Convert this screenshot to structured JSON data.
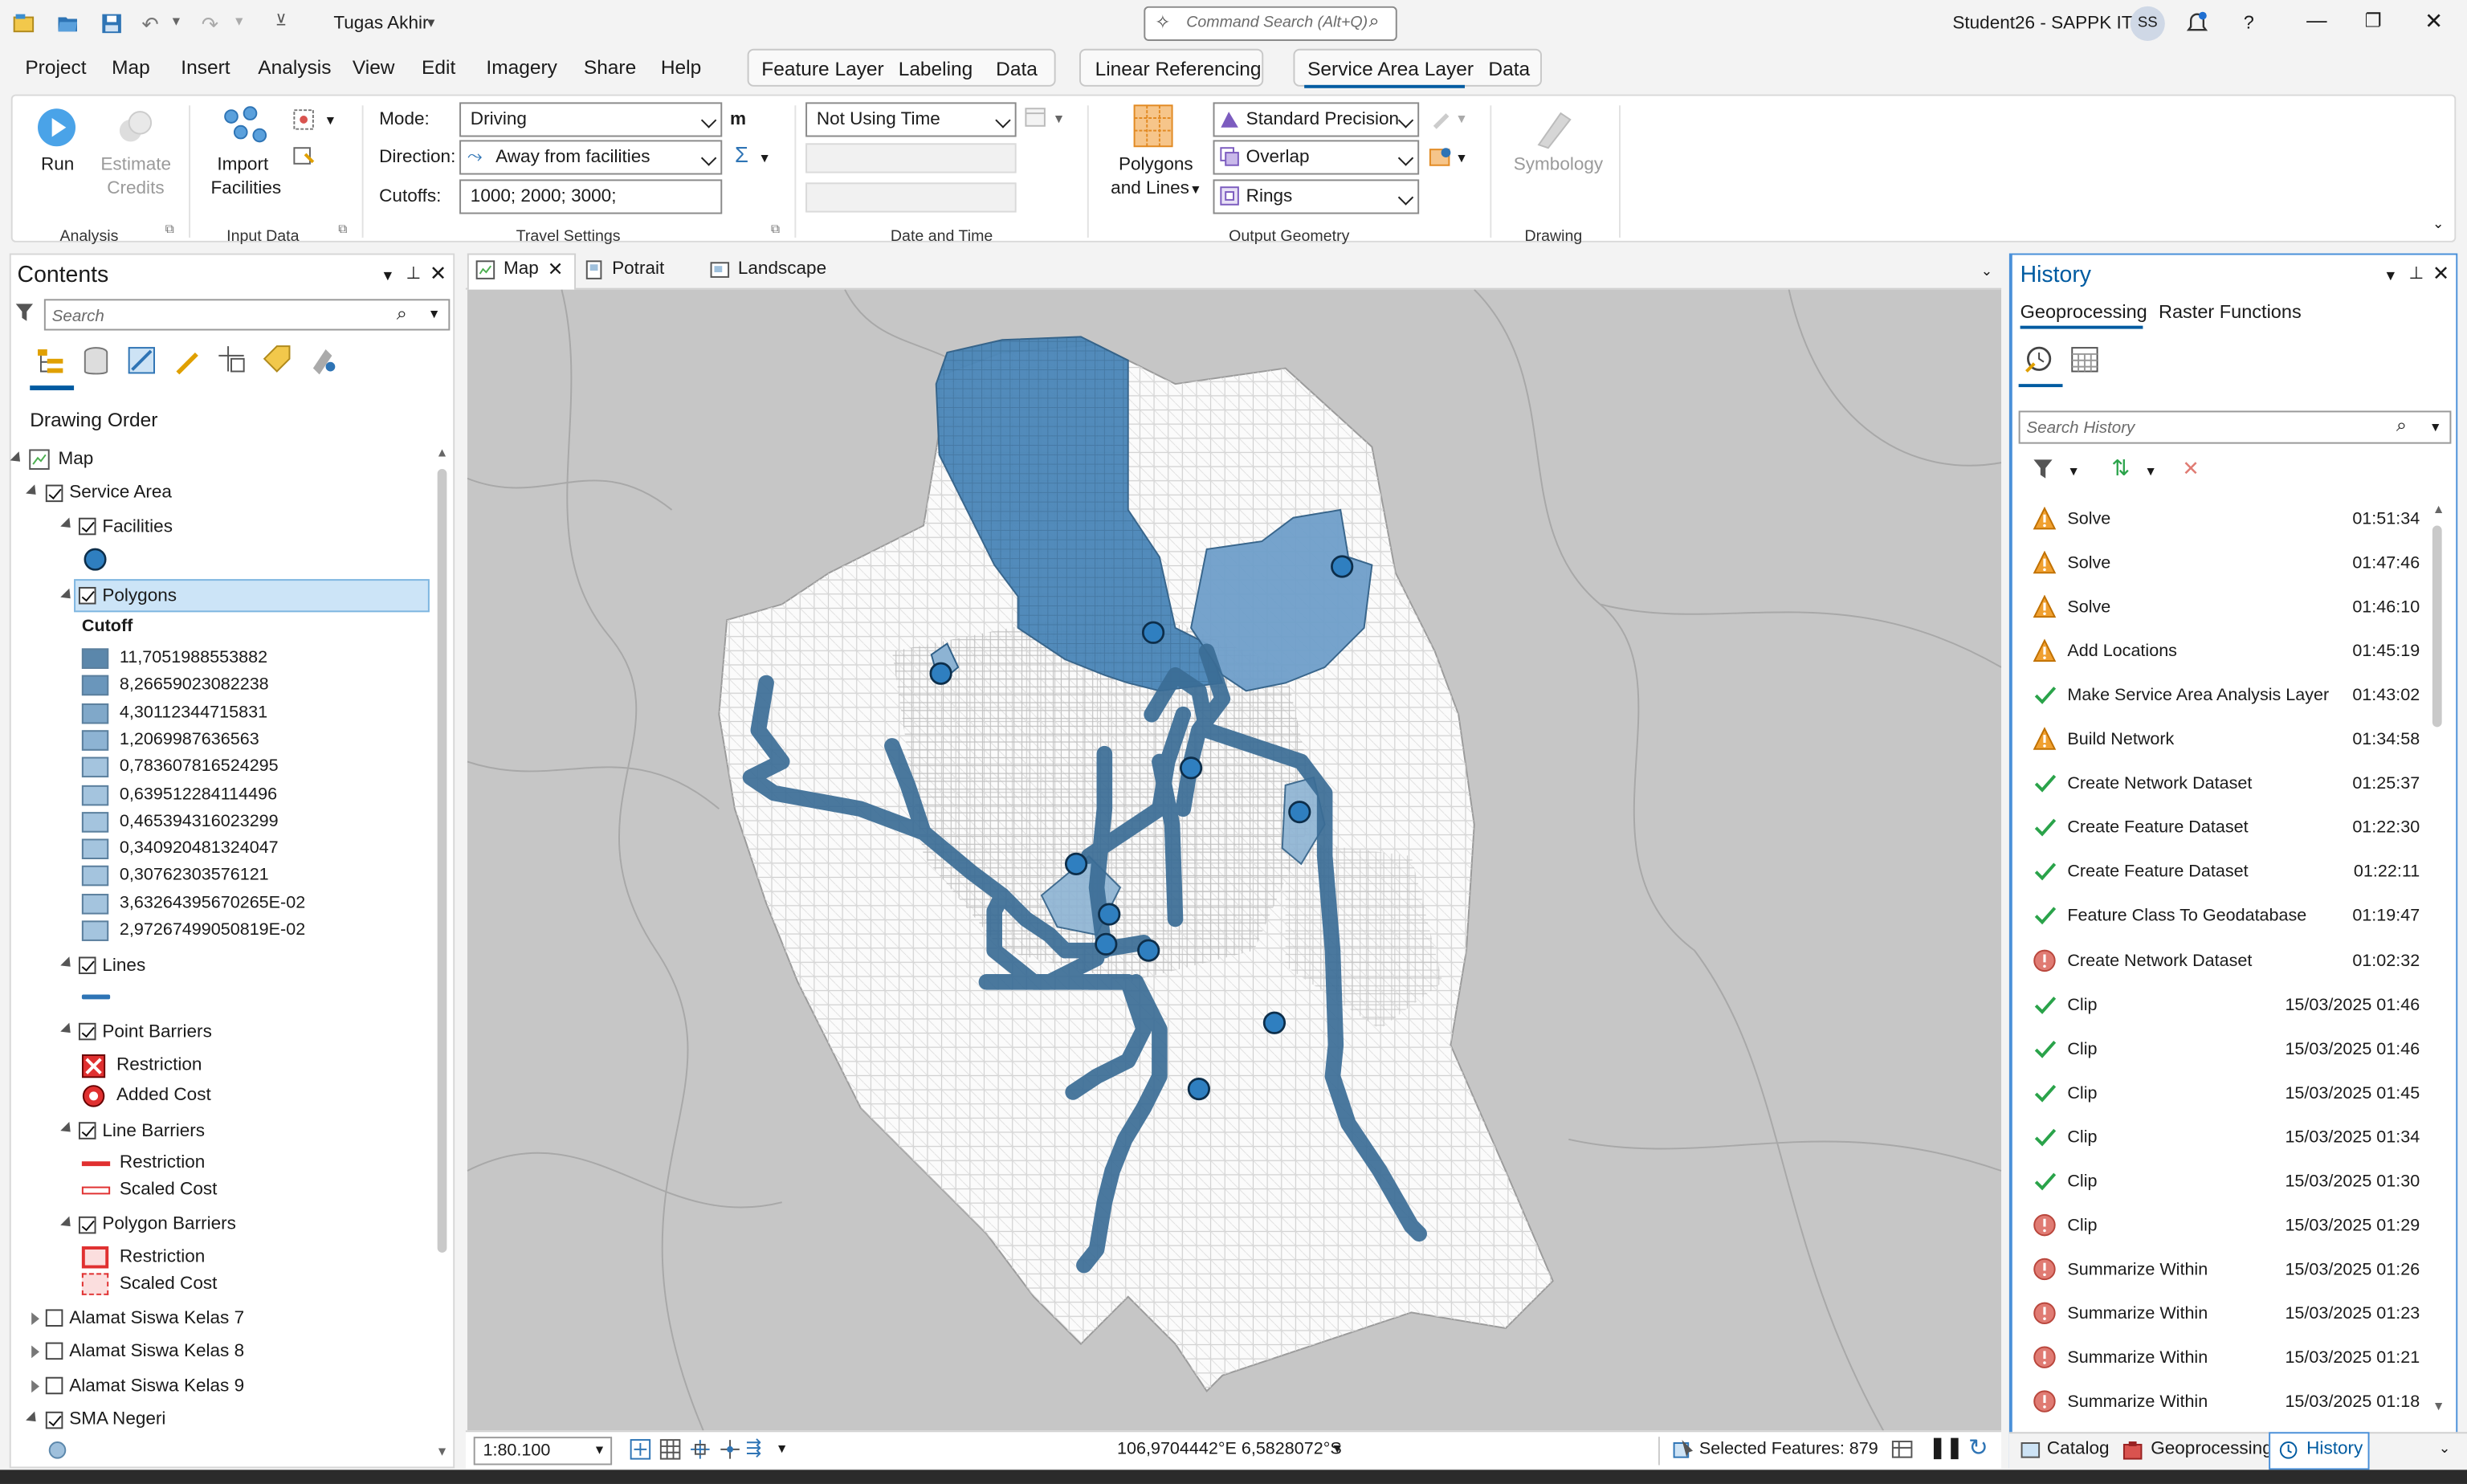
{
  "titlebar": {
    "project_name": "Tugas Akhir",
    "command_search_placeholder": "Command Search (Alt+Q)",
    "user_info": "Student26 - SAPPK ITB",
    "user_initials": "SS"
  },
  "menu": {
    "items": [
      "Project",
      "Map",
      "Insert",
      "Analysis",
      "View",
      "Edit",
      "Imagery",
      "Share",
      "Help"
    ],
    "context_tabs": [
      "Feature Layer",
      "Labeling",
      "Data",
      "Linear Referencing",
      "Service Area Layer",
      "Data"
    ],
    "active_context_tab": "Service Area Layer"
  },
  "ribbon": {
    "analysis": {
      "run": "Run",
      "estimate_credits_1": "Estimate",
      "estimate_credits_2": "Credits",
      "group": "Analysis"
    },
    "input_data": {
      "import_1": "Import",
      "import_2": "Facilities",
      "group": "Input Data"
    },
    "travel_settings": {
      "mode_label": "Mode:",
      "mode_value": "Driving",
      "direction_label": "Direction:",
      "direction_value": "Away from facilities",
      "cutoffs_label": "Cutoffs:",
      "cutoffs_value": "1000; 2000; 3000;",
      "unit": "m",
      "group": "Travel Settings"
    },
    "date_time": {
      "time_value": "Not Using Time",
      "group": "Date and Time"
    },
    "output_geometry": {
      "polygons_1": "Polygons",
      "polygons_2": "and Lines",
      "precision": "Standard Precision",
      "overlap": "Overlap",
      "rings": "Rings",
      "group": "Output Geometry"
    },
    "drawing": {
      "symbology": "Symbology",
      "group": "Drawing"
    }
  },
  "contents": {
    "title": "Contents",
    "search_placeholder": "Search",
    "drawing_order": "Drawing Order",
    "map_label": "Map",
    "service_area": "Service Area",
    "facilities": "Facilities",
    "polygons": "Polygons",
    "cutoff_label": "Cutoff",
    "legend": [
      {
        "label": "11,7051988553882",
        "color": "#5b87ab"
      },
      {
        "label": "8,26659023082238",
        "color": "#6a96bb"
      },
      {
        "label": "4,30112344715831",
        "color": "#80a8c9"
      },
      {
        "label": "1,2069987636563",
        "color": "#8db3d3"
      },
      {
        "label": "0,783607816524295",
        "color": "#a4c4de"
      },
      {
        "label": "0,639512284114496",
        "color": "#a4c4de"
      },
      {
        "label": "0,465394316023299",
        "color": "#a4c4de"
      },
      {
        "label": "0,340920481324047",
        "color": "#a4c4de"
      },
      {
        "label": "0,30762303576121",
        "color": "#a4c4de"
      },
      {
        "label": "3,63264395670265E-02",
        "color": "#a4c4de"
      },
      {
        "label": "2,97267499050819E-02",
        "color": "#a4c4de"
      }
    ],
    "lines": "Lines",
    "point_barriers": "Point Barriers",
    "restriction": "Restriction",
    "added_cost": "Added Cost",
    "line_barriers": "Line Barriers",
    "scaled_cost": "Scaled Cost",
    "polygon_barriers": "Polygon Barriers",
    "layers_after": [
      "Alamat Siswa Kelas 7",
      "Alamat Siswa Kelas 8",
      "Alamat Siswa Kelas 9",
      "SMA Negeri"
    ]
  },
  "map_view": {
    "tabs": [
      "Map",
      "Potrait",
      "Landscape"
    ],
    "scale": "1:80.100",
    "coordinates": "106,9704442°E 6,5828072°S",
    "selected_features": "Selected Features: 879"
  },
  "history": {
    "title": "History",
    "tabs": [
      "Geoprocessing",
      "Raster Functions"
    ],
    "search_placeholder": "Search History",
    "items": [
      {
        "name": "Solve",
        "time": "01:51:34",
        "status": "warning"
      },
      {
        "name": "Solve",
        "time": "01:47:46",
        "status": "warning"
      },
      {
        "name": "Solve",
        "time": "01:46:10",
        "status": "warning"
      },
      {
        "name": "Add Locations",
        "time": "01:45:19",
        "status": "warning"
      },
      {
        "name": "Make Service Area Analysis Layer",
        "time": "01:43:02",
        "status": "success"
      },
      {
        "name": "Build Network",
        "time": "01:34:58",
        "status": "warning"
      },
      {
        "name": "Create Network Dataset",
        "time": "01:25:37",
        "status": "success"
      },
      {
        "name": "Create Feature Dataset",
        "time": "01:22:30",
        "status": "success"
      },
      {
        "name": "Create Feature Dataset",
        "time": "01:22:11",
        "status": "success"
      },
      {
        "name": "Feature Class To Geodatabase",
        "time": "01:19:47",
        "status": "success"
      },
      {
        "name": "Create Network Dataset",
        "time": "01:02:32",
        "status": "error"
      },
      {
        "name": "Clip",
        "time": "15/03/2025 01:46",
        "status": "success"
      },
      {
        "name": "Clip",
        "time": "15/03/2025 01:46",
        "status": "success"
      },
      {
        "name": "Clip",
        "time": "15/03/2025 01:45",
        "status": "success"
      },
      {
        "name": "Clip",
        "time": "15/03/2025 01:34",
        "status": "success"
      },
      {
        "name": "Clip",
        "time": "15/03/2025 01:30",
        "status": "success"
      },
      {
        "name": "Clip",
        "time": "15/03/2025 01:29",
        "status": "error"
      },
      {
        "name": "Summarize Within",
        "time": "15/03/2025 01:26",
        "status": "error"
      },
      {
        "name": "Summarize Within",
        "time": "15/03/2025 01:23",
        "status": "error"
      },
      {
        "name": "Summarize Within",
        "time": "15/03/2025 01:21",
        "status": "error"
      },
      {
        "name": "Summarize Within",
        "time": "15/03/2025 01:18",
        "status": "error"
      }
    ],
    "bottom_tabs": [
      "Catalog",
      "Geoprocessing",
      "History"
    ]
  },
  "colors": {
    "accent": "#005ba1",
    "service_area": "#4a86b8",
    "route": "#3b6d96",
    "facility": "#2f7fc0"
  }
}
